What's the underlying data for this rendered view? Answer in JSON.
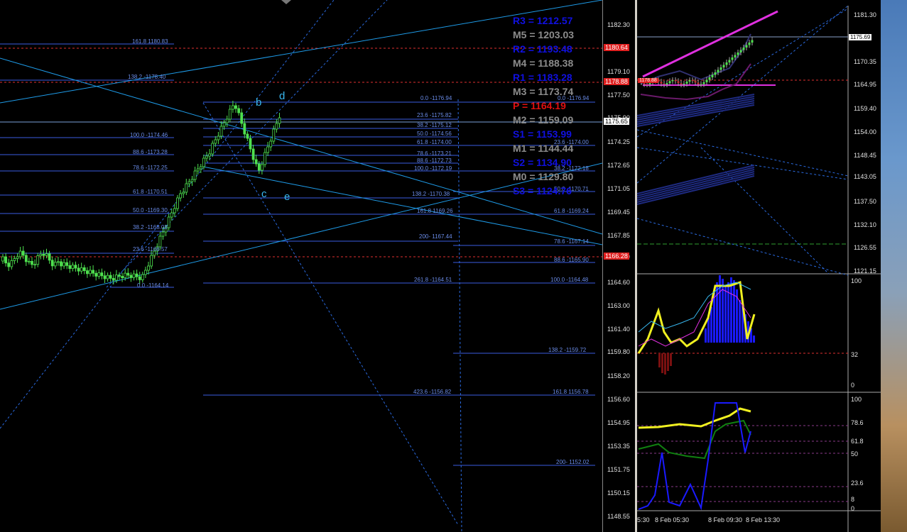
{
  "main_axis": [
    "1182.30",
    "1179.10",
    "1177.50",
    "1175.90",
    "1174.25",
    "1172.65",
    "1171.05",
    "1169.45",
    "1167.85",
    "1166.20",
    "1164.60",
    "1163.00",
    "1161.40",
    "1159.80",
    "1158.20",
    "1156.60",
    "1154.95",
    "1153.35",
    "1151.75",
    "1150.15",
    "1148.55"
  ],
  "main_price_tags": {
    "upper_red": "1180.64",
    "lower_red": "1178.88",
    "current": "1175.65",
    "bottom_red": "1166.28"
  },
  "pivots": [
    {
      "label": "R3 = 1212.57",
      "color": "#1010e0"
    },
    {
      "label": "M5 = 1203.03",
      "color": "#8c8c8c"
    },
    {
      "label": "R2 = 1193.48",
      "color": "#1010e0"
    },
    {
      "label": "M4 = 1188.38",
      "color": "#8c8c8c"
    },
    {
      "label": "R1 = 1183.28",
      "color": "#1010e0"
    },
    {
      "label": "M3 = 1173.74",
      "color": "#8c8c8c"
    },
    {
      "label": "P  = 1164.19",
      "color": "#e01010"
    },
    {
      "label": "M2 = 1159.09",
      "color": "#8c8c8c"
    },
    {
      "label": "S1 = 1153.99",
      "color": "#1010e0"
    },
    {
      "label": "M1 = 1144.44",
      "color": "#8c8c8c"
    },
    {
      "label": "S2 = 1134.90",
      "color": "#1010e0"
    },
    {
      "label": "M0 = 1129.80",
      "color": "#8c8c8c"
    },
    {
      "label": "S3 = 1124.76",
      "color": "#1010e0"
    }
  ],
  "fib_left": [
    "161.8 1180.83",
    "138.2 -1178.40",
    "100.0 -1174.46",
    "88.6 -1173.28",
    "78.6 -1172.25",
    "61.8 -1170.51",
    "50.0 -1169.30",
    "38.2 -1168.08",
    "23.6 -1166.57",
    "0.0 -1164.14"
  ],
  "fib_mid": [
    "0.0 -1176.94",
    "23.6 -1175.82",
    "38.2 -1175.12",
    "50.0 -1174.56",
    "61.8 -1174.00",
    "78.6 -1173.21",
    "88.6 -1172.73",
    "100.0 -1172.19",
    "138.2 -1170.38",
    "161.8 1169.26",
    "200- 1167.44",
    "261.8 -1164.51",
    "423.6 -1156.82"
  ],
  "fib_right": [
    "0.0 -1176.94",
    "23.6 -1174.00",
    "38.2 -1172.18",
    "50.0 -1170.71",
    "61.8 -1169.24",
    "78.6 -1167.14",
    "88.6 -1165.90",
    "100.0 -1164.48",
    "138.2 -1159.72",
    "161.8 1156.78",
    "200- 1152.02"
  ],
  "wave_labels": {
    "b": "b",
    "c": "c",
    "d": "d",
    "e": "e"
  },
  "right_price_axis": [
    "1181.30",
    "1175.69",
    "1170.35",
    "1164.95",
    "1159.40",
    "1154.00",
    "1148.45",
    "1143.05",
    "1137.50",
    "1132.10",
    "1126.55",
    "1121.15"
  ],
  "right_price_tags": {
    "current": "1175.69",
    "red": "1178.88"
  },
  "osc1_axis": [
    "100",
    "32",
    "0"
  ],
  "osc2_axis": [
    "100",
    "78.6",
    "61.8",
    "50",
    "23.6",
    "8",
    "0"
  ],
  "time_axis": [
    "5:30",
    "8 Feb 05:30",
    "8 Feb 09:30",
    "8 Feb 13:30"
  ],
  "colors": {
    "fib": "#3a5ce0",
    "trend": "#1e9be8",
    "red_dash": "#e03030",
    "candle": "#4ee04e",
    "pink": "#e030e0",
    "yellow": "#f0f020"
  }
}
